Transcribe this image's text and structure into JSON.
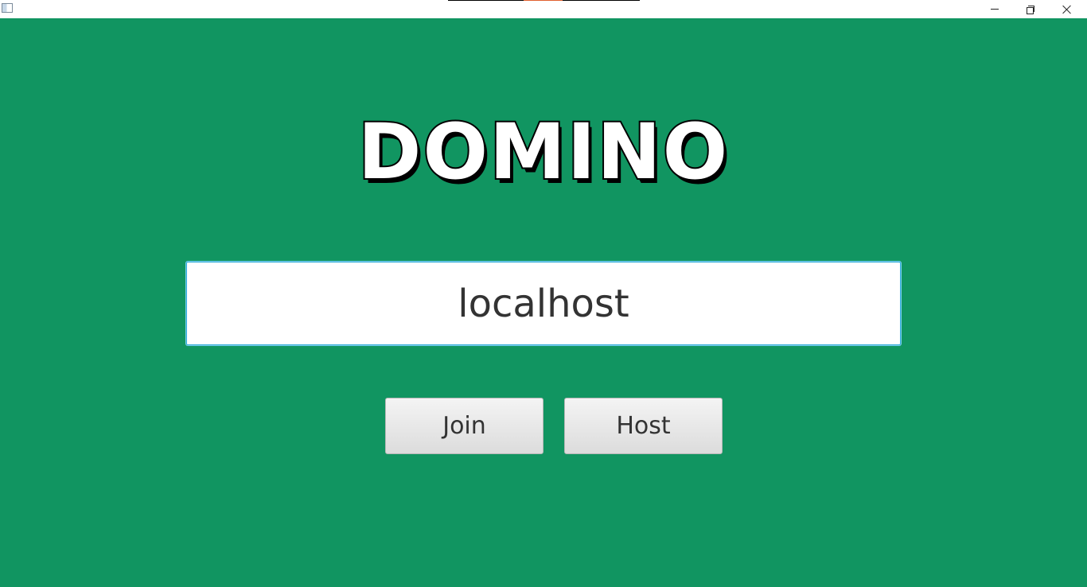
{
  "window": {
    "title": "",
    "controls": {
      "minimize_icon": "minimize-icon",
      "maximize_icon": "restore-icon",
      "close_icon": "close-icon"
    }
  },
  "main": {
    "logo_text": "DOMINO",
    "server_input": {
      "value": "localhost",
      "placeholder": ""
    },
    "buttons": {
      "join_label": "Join",
      "host_label": "Host"
    }
  },
  "colors": {
    "background": "#119561",
    "logo_fill": "#ffffff",
    "logo_shadow": "#000000",
    "input_focus_border": "#2aa9d8"
  }
}
